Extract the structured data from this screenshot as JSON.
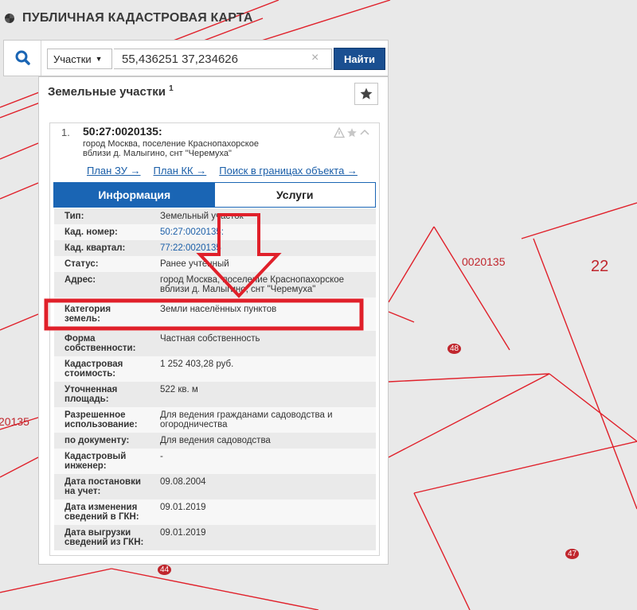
{
  "app": {
    "title": "ПУБЛИЧНАЯ КАДАСТРОВАЯ КАРТА"
  },
  "search": {
    "type_selected": "Участки",
    "query": "55,436251 37,234626",
    "clear_symbol": "×",
    "find_label": "Найти"
  },
  "panel": {
    "title": "Земельные участки",
    "count": "1"
  },
  "item": {
    "num": "1.",
    "id": "50:27:0020135:",
    "address_line1": "город Москва, поселение Краснопахорское",
    "address_line2": "вблизи д. Малыгино, снт \"Черемуха\"",
    "links": [
      "План ЗУ →",
      "План КК →",
      "Поиск в границах объекта →"
    ]
  },
  "tabs": [
    "Информация",
    "Услуги"
  ],
  "rows": [
    {
      "k": "Тип:",
      "v": "Земельный участок"
    },
    {
      "k": "Кад. номер:",
      "v": "50:27:0020135:"
    },
    {
      "k": "Кад. квартал:",
      "v": "77:22:0020135"
    },
    {
      "k": "Статус:",
      "v": "Ранее учтенный"
    },
    {
      "k": "Адрес:",
      "v": "город Москва, поселение Краснопахорское вблизи д. Малыгино, снт \"Черемуха\""
    },
    {
      "k": "Категория земель:",
      "v": "Земли населённых пунктов"
    },
    {
      "k": "Форма собственности:",
      "v": "Частная собственность"
    },
    {
      "k": "Кадастровая стоимость:",
      "v": "1 252 403,28 руб."
    },
    {
      "k": "Уточненная площадь:",
      "v": "522 кв. м"
    },
    {
      "k": "Разрешенное использование:",
      "v": "Для ведения гражданами садоводства и огородничества"
    },
    {
      "k": "по документу:",
      "v": "Для ведения садоводства"
    },
    {
      "k": "Кадастровый инженер:",
      "v": "-"
    },
    {
      "k": "Дата постановки на учет:",
      "v": "09.08.2004"
    },
    {
      "k": "Дата изменения сведений в ГКН:",
      "v": "09.01.2019"
    },
    {
      "k": "Дата выгрузки сведений из ГКН:",
      "v": "09.01.2019"
    }
  ],
  "map": {
    "label_a": "0020135",
    "label_b": "22",
    "label_c": "20135",
    "badge_48": "48",
    "badge_47": "47",
    "badge_44": "44"
  },
  "colors": {
    "boundary": "#e0202a",
    "primary": "#1a65b4",
    "button": "#1a4f91"
  }
}
